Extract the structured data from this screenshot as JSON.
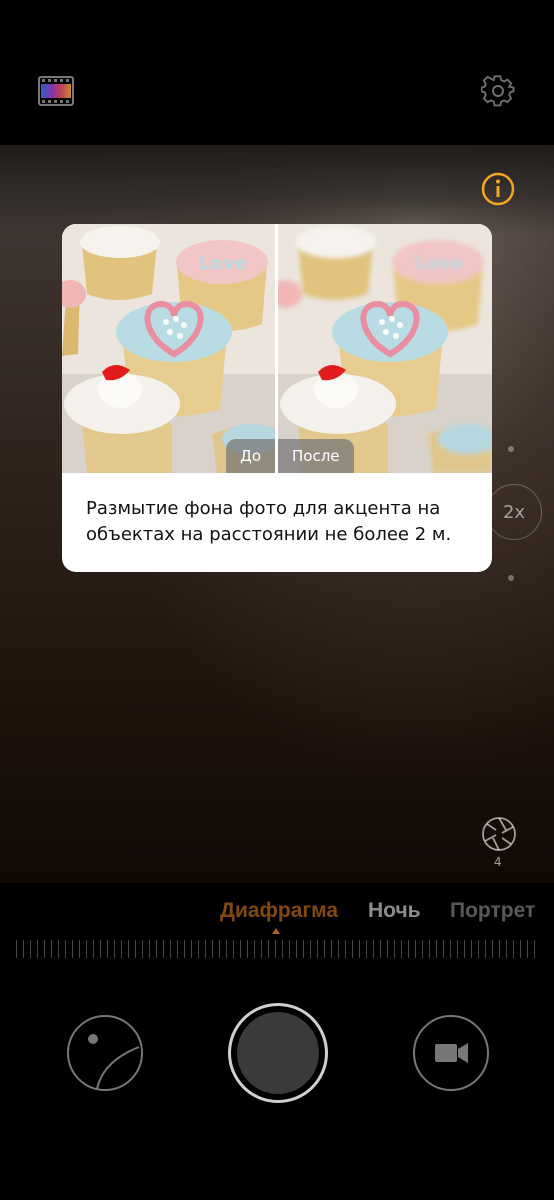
{
  "colors": {
    "accent": "#f5a623",
    "active_mode": "#d8781e",
    "card_bg": "#ffffff"
  },
  "toolbar": {
    "filter_icon": "film-strip-icon",
    "settings_icon": "gear-icon",
    "info_icon": "info-icon"
  },
  "tooltip": {
    "before_label": "До",
    "after_label": "После",
    "description": "Размытие фона фото для акцента на объектах на расстоянии не более 2 м."
  },
  "viewfinder": {
    "zoom_label": "2x",
    "aperture_value": "4"
  },
  "modes": {
    "items": [
      "Диафрагма",
      "Ночь",
      "Портрет"
    ],
    "active": "Диафрагма"
  },
  "controls": {
    "gallery_icon": "gallery-thumbnail-icon",
    "shutter_icon": "shutter-button",
    "video_icon": "video-camera-icon"
  }
}
